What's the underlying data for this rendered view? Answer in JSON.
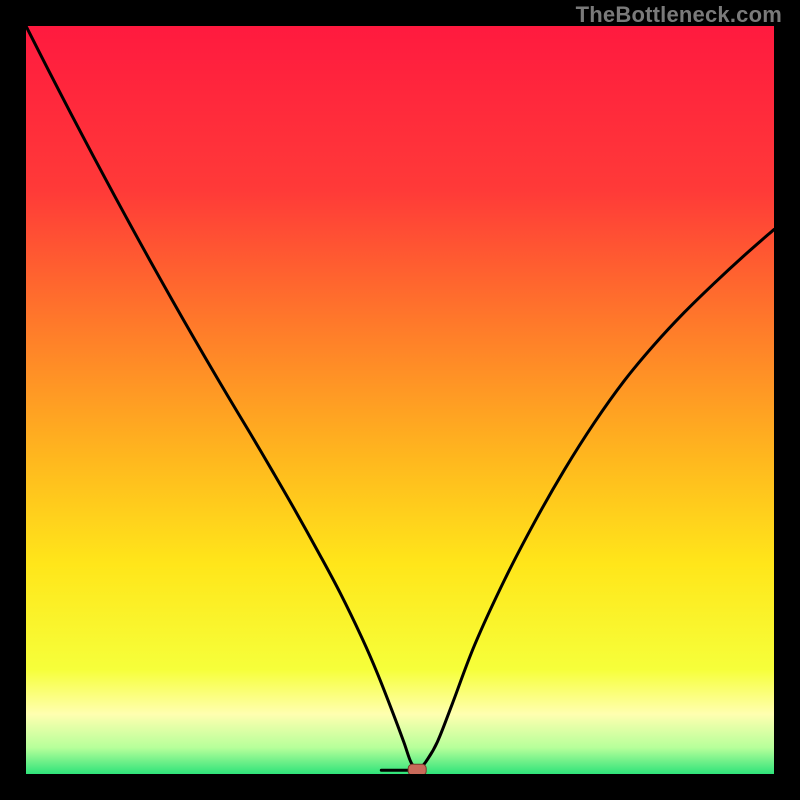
{
  "watermark": "TheBottleneck.com",
  "colors": {
    "frame": "#000000",
    "watermark": "#7a7a7a",
    "gradient_stops": [
      {
        "offset": 0.0,
        "color": "#ff1a3f"
      },
      {
        "offset": 0.22,
        "color": "#ff3a38"
      },
      {
        "offset": 0.4,
        "color": "#ff7a2a"
      },
      {
        "offset": 0.58,
        "color": "#ffb81e"
      },
      {
        "offset": 0.72,
        "color": "#ffe61a"
      },
      {
        "offset": 0.86,
        "color": "#f6ff3a"
      },
      {
        "offset": 0.92,
        "color": "#ffffb0"
      },
      {
        "offset": 0.965,
        "color": "#b6ff9a"
      },
      {
        "offset": 1.0,
        "color": "#2fe37a"
      }
    ],
    "curve_stroke": "#000000",
    "marker_fill": "#c96a5a",
    "marker_stroke": "#7a3a2a"
  },
  "chart_data": {
    "type": "line",
    "title": "",
    "xlabel": "",
    "ylabel": "",
    "xlim": [
      0,
      100
    ],
    "ylim": [
      0,
      100
    ],
    "grid": false,
    "legend": false,
    "x": [
      0,
      3,
      6,
      9,
      12,
      15,
      18,
      21,
      24,
      27,
      30,
      33,
      36,
      39,
      42,
      45,
      47,
      49,
      50.5,
      51.5,
      52.5,
      53.5,
      55,
      57,
      60,
      64,
      68,
      72,
      76,
      80,
      84,
      88,
      92,
      96,
      100
    ],
    "values": [
      100,
      94.1,
      88.3,
      82.6,
      77.0,
      71.5,
      66.1,
      60.8,
      55.6,
      50.5,
      45.5,
      40.4,
      35.2,
      29.8,
      24.2,
      18.0,
      13.4,
      8.3,
      4.3,
      1.5,
      0.5,
      1.7,
      4.3,
      9.4,
      17.3,
      26.0,
      33.7,
      40.7,
      47.0,
      52.6,
      57.4,
      61.7,
      65.6,
      69.3,
      72.8
    ],
    "baseline_segment": {
      "x0": 47.5,
      "x1": 52.5,
      "y": 0.5
    },
    "marker": {
      "x": 52.3,
      "y": 0.5
    }
  }
}
